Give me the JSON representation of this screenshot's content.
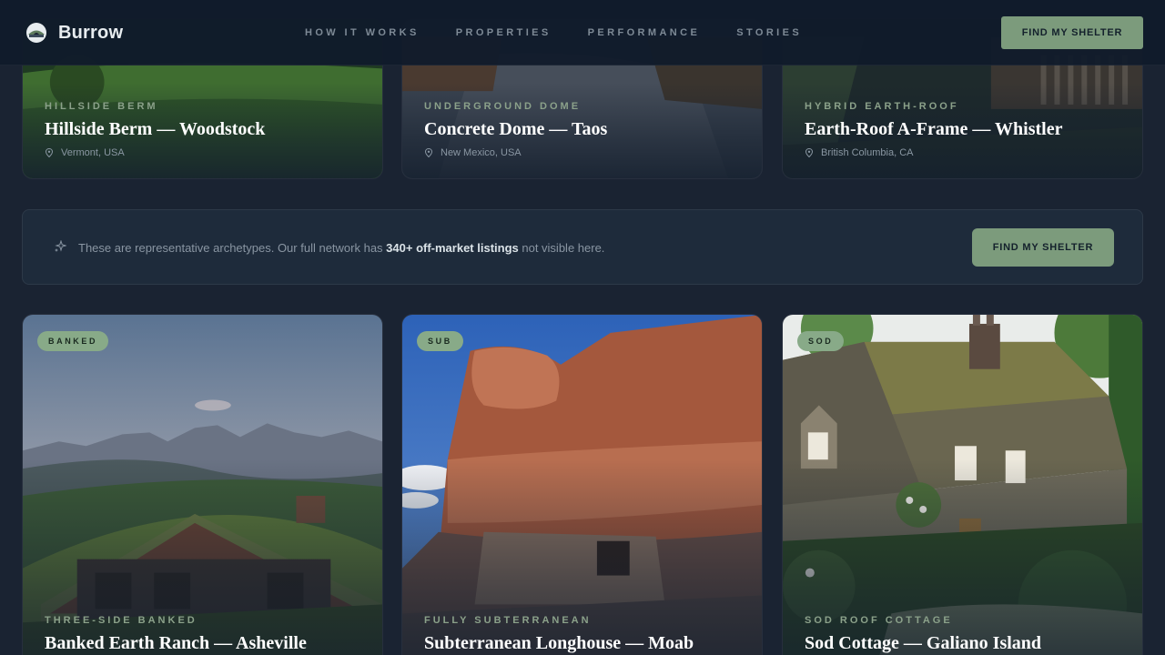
{
  "nav": {
    "brand": "Burrow",
    "links": [
      "HOW IT WORKS",
      "PROPERTIES",
      "PERFORMANCE",
      "STORIES"
    ],
    "cta": "FIND MY SHELTER"
  },
  "top_cards": [
    {
      "category": "HILLSIDE BERM",
      "title": "Hillside Berm — Woodstock",
      "location": "Vermont, USA"
    },
    {
      "category": "UNDERGROUND DOME",
      "title": "Concrete Dome — Taos",
      "location": "New Mexico, USA"
    },
    {
      "category": "HYBRID EARTH-ROOF",
      "title": "Earth-Roof A-Frame — Whistler",
      "location": "British Columbia, CA"
    }
  ],
  "banner": {
    "text_before": "These are representative archetypes. Our full network has ",
    "text_bold": "340+ off-market listings",
    "text_after": " not visible here.",
    "cta": "FIND MY SHELTER"
  },
  "bottom_cards": [
    {
      "tag": "BANKED",
      "category": "THREE-SIDE BANKED",
      "title": "Banked Earth Ranch — Asheville"
    },
    {
      "tag": "SUB",
      "category": "FULLY SUBTERRANEAN",
      "title": "Subterranean Longhouse — Moab"
    },
    {
      "tag": "SOD",
      "category": "SOD ROOF COTTAGE",
      "title": "Sod Cottage — Galiano Island"
    }
  ],
  "colors": {
    "background": "#1a2332",
    "accent_green": "#7c9b7c",
    "tag_green": "#88aa88",
    "category_text": "#8ba18a"
  }
}
